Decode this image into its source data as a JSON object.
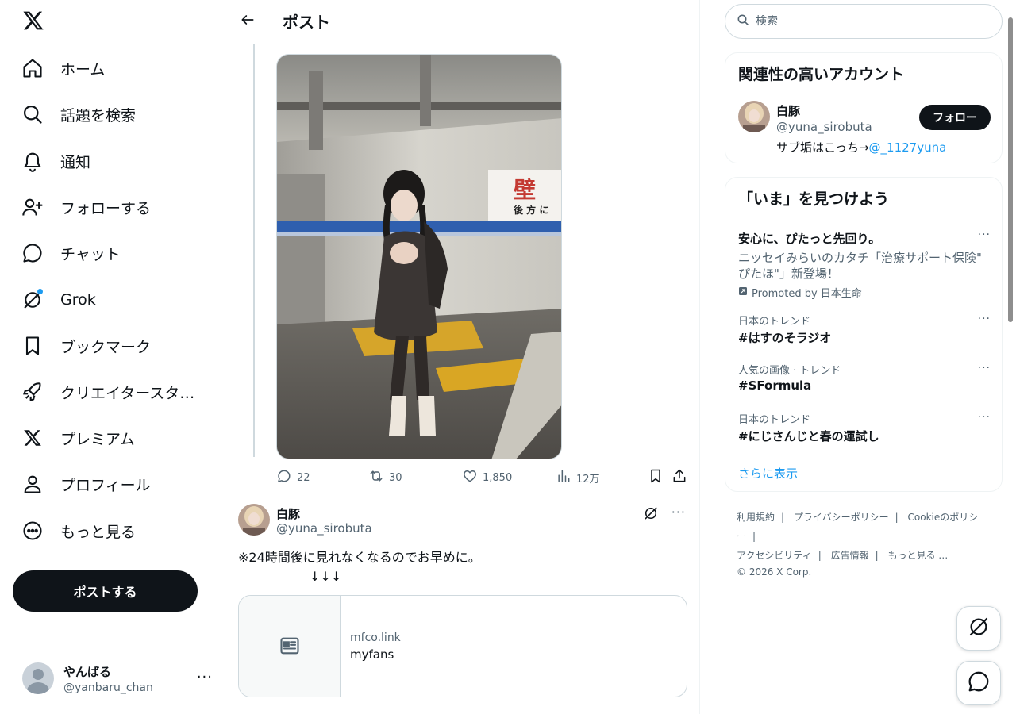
{
  "left_nav": {
    "items": [
      {
        "label": "ホーム",
        "icon": "home-icon"
      },
      {
        "label": "話題を検索",
        "icon": "search-icon"
      },
      {
        "label": "通知",
        "icon": "bell-icon"
      },
      {
        "label": "フォローする",
        "icon": "add-user-icon"
      },
      {
        "label": "チャット",
        "icon": "chat-icon"
      },
      {
        "label": "Grok",
        "icon": "grok-icon"
      },
      {
        "label": "ブックマーク",
        "icon": "bookmark-icon"
      },
      {
        "label": "クリエイタースタ…",
        "icon": "rocket-icon"
      },
      {
        "label": "プレミアム",
        "icon": "x-logo-icon"
      },
      {
        "label": "プロフィール",
        "icon": "person-icon"
      },
      {
        "label": "もっと見る",
        "icon": "more-circle-icon"
      }
    ],
    "post_button": "ポストする",
    "account": {
      "name": "やんばる",
      "handle": "@yanbaru_chan",
      "more": "···"
    }
  },
  "header": {
    "title": "ポスト"
  },
  "post_actions": {
    "replies": "22",
    "reposts": "30",
    "likes": "1,850",
    "views": "12万"
  },
  "reply_post": {
    "name": "白豚",
    "handle": "@yuna_sirobuta",
    "more": "···",
    "text_line1": "※24時間後に見れなくなるのでお早めに。",
    "text_line2": "↓↓↓",
    "card": {
      "domain": "mfco.link",
      "title": "myfans"
    }
  },
  "right": {
    "search_placeholder": "検索",
    "related": {
      "heading": "関連性の高いアカウント",
      "name": "白豚",
      "handle": "@yuna_sirobuta",
      "bio_text": "サブ垢はこっち→",
      "bio_link": "@_1127yuna",
      "follow_label": "フォロー"
    },
    "trends": {
      "heading": "「いま」を見つけよう",
      "promo": {
        "title": "安心に、ぴたっと先回り。",
        "desc": "ニッセイみらいのカタチ「治療サポート保険\" ぴたほ\"」新登場！",
        "by": "Promoted by 日本生命"
      },
      "items": [
        {
          "context": "日本のトレンド",
          "title": "#はすのそラジオ"
        },
        {
          "context": "人気の画像 · トレンド",
          "title": "#SFormula"
        },
        {
          "context": "日本のトレンド",
          "title": "#にじさんじと春の運試し"
        }
      ],
      "dots": "···",
      "show_more": "さらに表示"
    },
    "footer": {
      "links": [
        "利用規約",
        "プライバシーポリシー",
        "Cookieのポリシー",
        "アクセシビリティ",
        "広告情報",
        "もっと見る …"
      ],
      "copyright": "© 2026 X Corp."
    }
  },
  "colors": {
    "accent": "#1d9bf0",
    "text": "#0f1419",
    "muted": "#536471",
    "border": "#eff3f4"
  }
}
